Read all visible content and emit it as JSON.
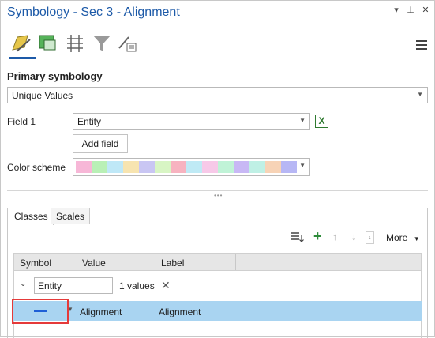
{
  "window": {
    "title": "Symbology - Sec 3 - Alignment"
  },
  "title_controls": [
    "▾",
    "⊥",
    "✕"
  ],
  "icons": [
    "primary-symbology-icon",
    "vary-symbology-icon",
    "label-classes-icon",
    "filter-icon",
    "more-options-icon"
  ],
  "primary": {
    "heading": "Primary symbology",
    "method": "Unique Values"
  },
  "field1": {
    "label": "Field 1",
    "value": "Entity",
    "add_field": "Add field"
  },
  "color_scheme": {
    "label": "Color scheme",
    "colors": [
      "#f7b7d7",
      "#b9f0b6",
      "#bfe8f7",
      "#f7e4b0",
      "#c9c6f3",
      "#d8f5c4",
      "#f7b3c0",
      "#bfeaf5",
      "#f7c9e8",
      "#c0f3d7",
      "#c8b8f5",
      "#bff0e5",
      "#f7d3b6",
      "#b7b7f5"
    ]
  },
  "tabs": {
    "classes": "Classes",
    "scales": "Scales"
  },
  "toolbar": {
    "more": "More"
  },
  "grid": {
    "columns": {
      "symbol": "Symbol",
      "value": "Value",
      "label": "Label"
    },
    "group": {
      "field": "Entity",
      "count": "1 values"
    },
    "rows": [
      {
        "value": "Alignment",
        "label": "Alignment",
        "line_color": "#1e5fd6"
      }
    ]
  }
}
